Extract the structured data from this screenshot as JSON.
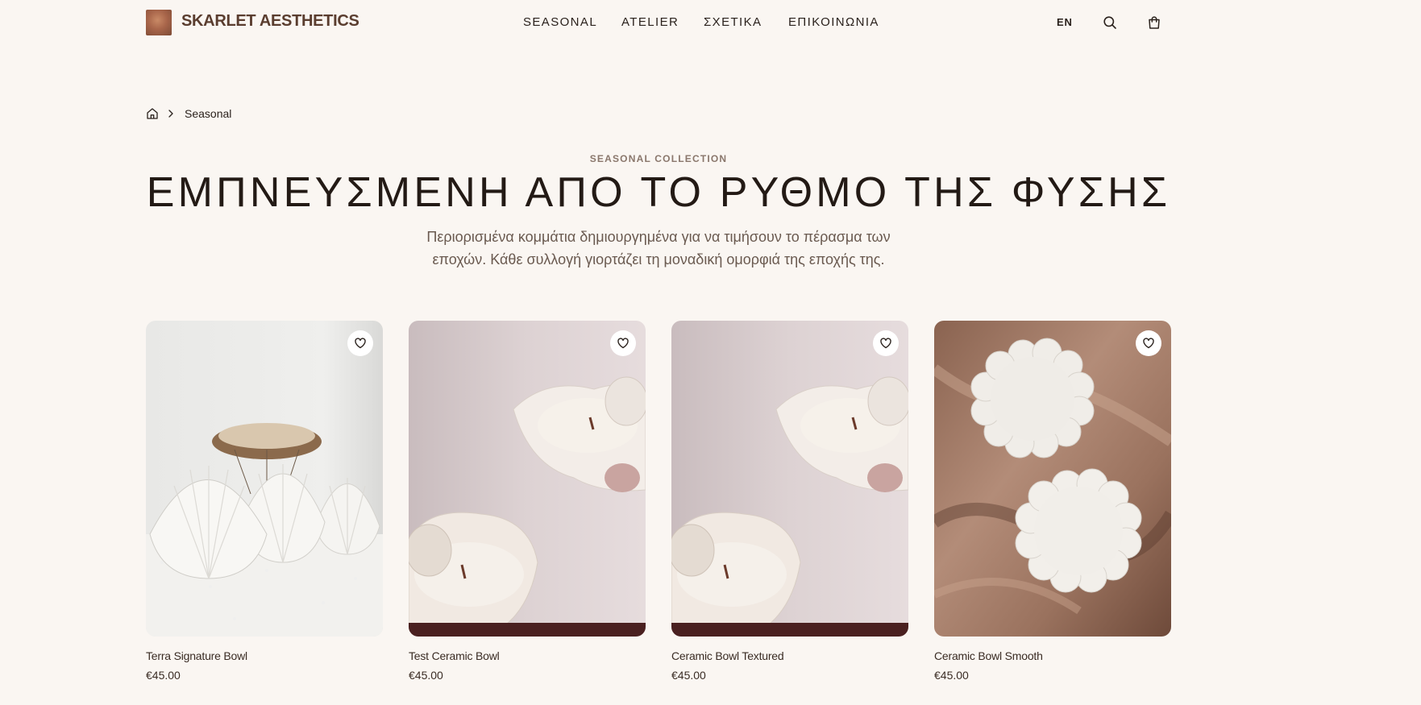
{
  "brand": {
    "name": "SKARLET AESTHETICS",
    "logo_icon": "brand-logo"
  },
  "nav": {
    "items": [
      "SEASONAL",
      "ATELIER",
      "ΣΧΕΤΙΚΑ",
      "ΕΠΙΚΟΙΝΩΝΙΑ"
    ]
  },
  "header_actions": {
    "language": "EN",
    "search_icon": "search-icon",
    "cart_icon": "shopping-bag-icon"
  },
  "breadcrumb": {
    "home_icon": "home-icon",
    "separator_icon": "chevron-right-icon",
    "current": "Seasonal"
  },
  "hero": {
    "eyebrow": "SEASONAL COLLECTION",
    "title": "ΕΜΠΝΕΥΣΜΕΝΗ ΑΠΟ ΤΟ ΡΥΘΜΟ ΤΗΣ ΦΥΣΗΣ",
    "subtitle_line1": "Περιορισμένα κομμάτια δημιουργημένα για να τιμήσουν το πέρασμα των",
    "subtitle_line2": "εποχών. Κάθε συλλογή γιορτάζει τη μοναδική ομορφιά της εποχής της."
  },
  "products": [
    {
      "name": "Terra Signature Bowl",
      "price": "€45.00",
      "favorite_icon": "heart-icon"
    },
    {
      "name": "Test Ceramic Bowl",
      "price": "€45.00",
      "favorite_icon": "heart-icon"
    },
    {
      "name": "Ceramic Bowl Textured",
      "price": "€45.00",
      "favorite_icon": "heart-icon"
    },
    {
      "name": "Ceramic Bowl Smooth",
      "price": "€45.00",
      "favorite_icon": "heart-icon"
    }
  ],
  "colors": {
    "background": "#faf6f2",
    "brand": "#5a3d2f",
    "text": "#2a211c",
    "muted": "#8a776c"
  }
}
